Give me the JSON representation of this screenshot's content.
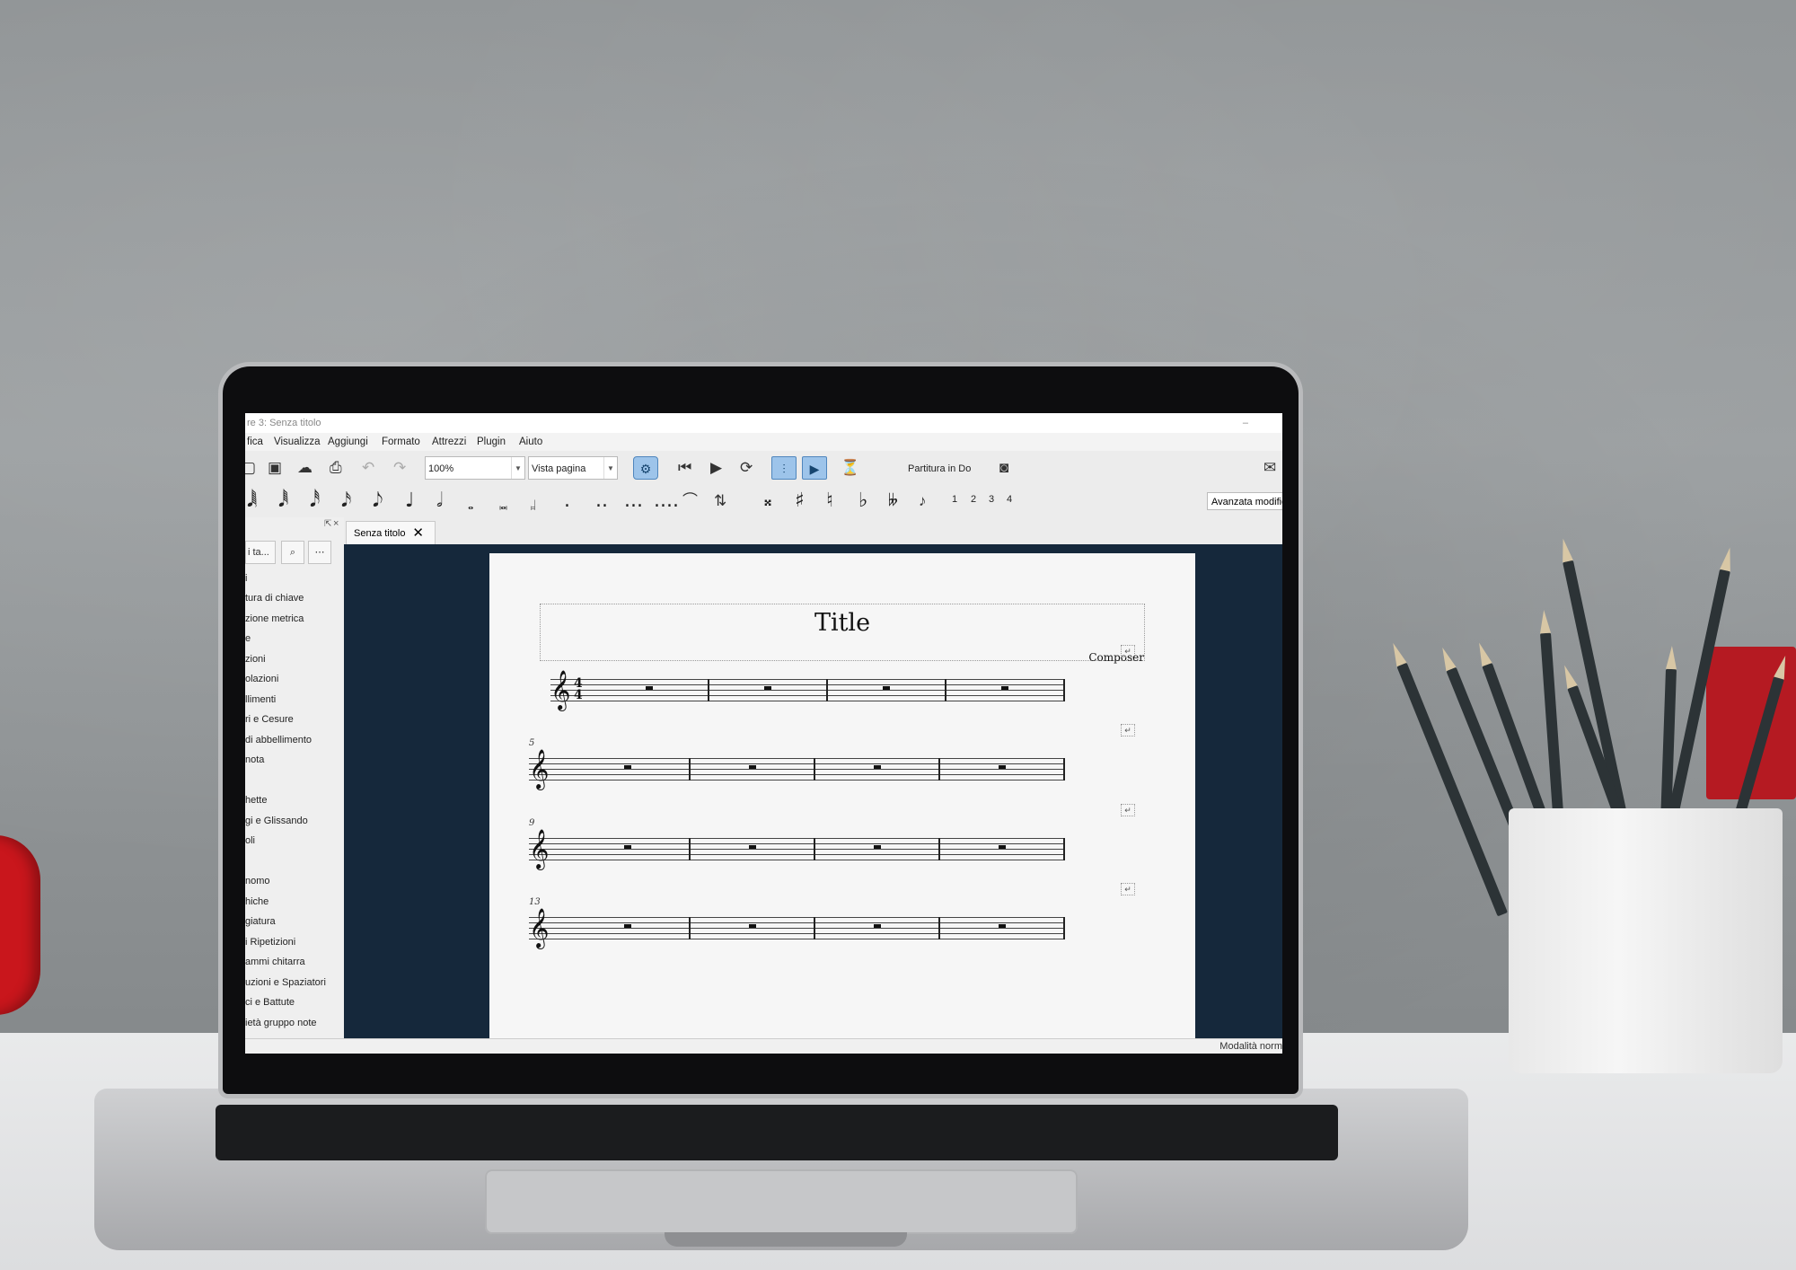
{
  "window": {
    "title": "re 3: Senza titolo",
    "minimize_glyph": "–"
  },
  "menu": [
    "fica",
    "Visualizza",
    "Aggiungi",
    "Formato",
    "Attrezzi",
    "Plugin",
    "Aiuto"
  ],
  "toolbar": {
    "zoom_value": "100%",
    "view_mode": "Vista pagina",
    "concert_pitch": "Partitura in Do",
    "icons": [
      "new-file-icon",
      "save-icon",
      "upload-cloud-icon",
      "print-icon",
      "undo-icon",
      "redo-icon",
      "midi-input-icon",
      "rewind-icon",
      "play-icon",
      "loop-icon",
      "loop-in-icon",
      "loop-out-icon",
      "metronome-icon",
      "camera-icon",
      "feedback-mail-icon"
    ]
  },
  "note_input": {
    "durations": [
      "𝅘𝅥𝅲",
      "𝅘𝅥𝅱",
      "𝅘𝅥𝅰",
      "𝅘𝅥𝅯",
      "𝅘𝅥𝅮",
      "♩",
      "𝅗𝅥",
      "𝅝",
      "𝅜",
      "𝆷"
    ],
    "dots": [
      ".",
      "..",
      "...",
      "...."
    ],
    "accidentals": [
      "𝄪",
      "♯",
      "♮",
      "♭",
      "𝄫"
    ],
    "voices": [
      "1",
      "2",
      "3",
      "4"
    ],
    "workspace": "Avanzata modific"
  },
  "palette": {
    "search_label": "i ta...",
    "search_icon": "search-icon",
    "more_label": "⋯",
    "items": [
      "i",
      "tura di chiave",
      "zione metrica",
      "e",
      "zioni",
      "olazioni",
      "llimenti",
      "ri e Cesure",
      "di abbellimento",
      "nota",
      "",
      "hette",
      "gi e Glissando",
      "oli",
      "",
      "nomo",
      "hiche",
      "giatura",
      "i Ripetizioni",
      "ammi chitarra",
      "uzioni e Spaziatori",
      "ci e Battute",
      "ietà gruppo note"
    ]
  },
  "tab": {
    "label": "Senza titolo",
    "close": "✕"
  },
  "score": {
    "title": "Title",
    "composer": "Composer",
    "clef": "𝄞",
    "time_signature": {
      "top": "4",
      "bottom": "4"
    },
    "systems": [
      {
        "start_measure": "",
        "measures": 4
      },
      {
        "start_measure": "5",
        "measures": 4
      },
      {
        "start_measure": "9",
        "measures": 4
      },
      {
        "start_measure": "13",
        "measures": 4
      }
    ]
  },
  "status": {
    "mode": "Modalità norm"
  }
}
